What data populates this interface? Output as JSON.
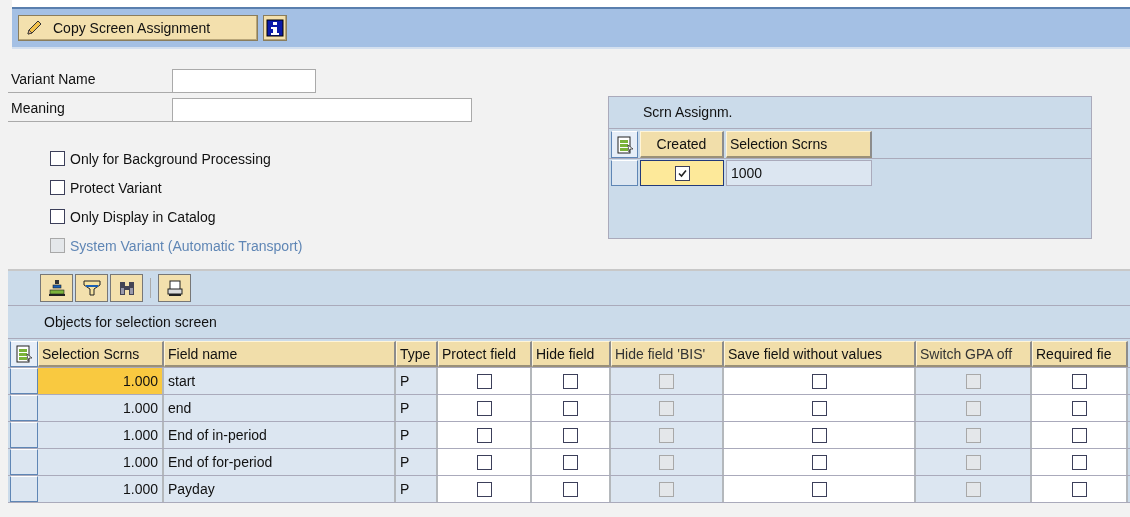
{
  "toolbar": {
    "buttons": [
      {
        "label": "Copy Screen Assignment"
      }
    ]
  },
  "fields": [
    {
      "label": "Variant Name"
    },
    {
      "label": "Meaning"
    }
  ],
  "options": [
    {
      "label": "Only for Background Processing",
      "checked": false,
      "disabled": false
    },
    {
      "label": "Protect Variant",
      "checked": false,
      "disabled": false
    },
    {
      "label": "Only Display in Catalog",
      "checked": false,
      "disabled": false
    },
    {
      "label": "System Variant (Automatic Transport)",
      "checked": false,
      "disabled": true
    }
  ],
  "screen_assignment": {
    "title": "Scrn Assignm.",
    "columns": [
      "Created",
      "Selection Scrns"
    ],
    "rows": [
      {
        "created": true,
        "selection_scrns": "1000"
      }
    ]
  },
  "objects_table": {
    "title": "Objects for selection screen",
    "columns": [
      {
        "label": "Selection Scrns",
        "kind": "number",
        "disabled": false
      },
      {
        "label": "Field name",
        "kind": "text",
        "disabled": false
      },
      {
        "label": "Type",
        "kind": "text",
        "disabled": false
      },
      {
        "label": "Protect field",
        "kind": "checkbox",
        "disabled": false
      },
      {
        "label": "Hide field",
        "kind": "checkbox",
        "disabled": false
      },
      {
        "label": "Hide field 'BIS'",
        "kind": "checkbox",
        "disabled": true
      },
      {
        "label": "Save field without values",
        "kind": "checkbox",
        "disabled": false
      },
      {
        "label": "Switch GPA off",
        "kind": "checkbox",
        "disabled": true
      },
      {
        "label": "Required fie",
        "kind": "checkbox",
        "disabled": false
      }
    ],
    "rows": [
      {
        "selected": true,
        "cells": [
          "1.000",
          "start",
          "P",
          false,
          false,
          false,
          false,
          false,
          false
        ]
      },
      {
        "selected": false,
        "cells": [
          "1.000",
          "end",
          "P",
          false,
          false,
          false,
          false,
          false,
          false
        ]
      },
      {
        "selected": false,
        "cells": [
          "1.000",
          "End of in-period",
          "P",
          false,
          false,
          false,
          false,
          false,
          false
        ]
      },
      {
        "selected": false,
        "cells": [
          "1.000",
          "End of for-period",
          "P",
          false,
          false,
          false,
          false,
          false,
          false
        ]
      },
      {
        "selected": false,
        "cells": [
          "1.000",
          "Payday",
          "P",
          false,
          false,
          false,
          false,
          false,
          false
        ]
      }
    ]
  }
}
